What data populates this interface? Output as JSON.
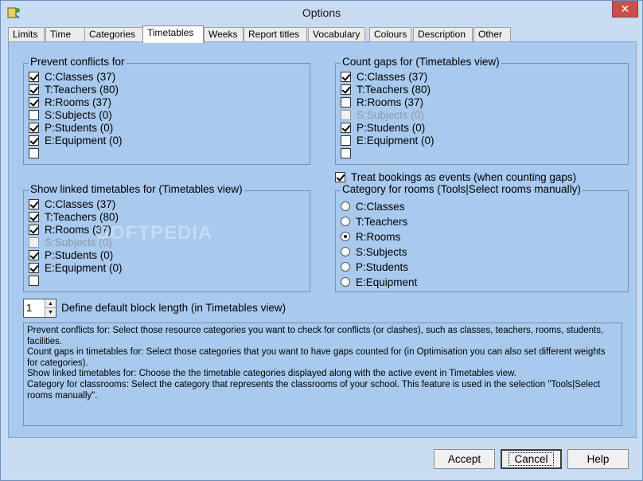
{
  "window": {
    "title": "Options",
    "close_label": "✕"
  },
  "tabs": [
    {
      "label": "Limits"
    },
    {
      "label": "Time"
    },
    {
      "label": "Categories"
    },
    {
      "label": "Timetables"
    },
    {
      "label": "Weeks"
    },
    {
      "label": "Report titles"
    },
    {
      "label": "Vocabulary"
    },
    {
      "label": "Colours"
    },
    {
      "label": "Description"
    },
    {
      "label": "Other"
    }
  ],
  "active_tab": "Timetables",
  "prevent_conflicts": {
    "legend": "Prevent conflicts for",
    "items": [
      {
        "label": "C:Classes (37)",
        "checked": true
      },
      {
        "label": "T:Teachers (80)",
        "checked": true
      },
      {
        "label": "R:Rooms (37)",
        "checked": true
      },
      {
        "label": "S:Subjects (0)",
        "checked": false
      },
      {
        "label": "P:Students (0)",
        "checked": true
      },
      {
        "label": "E:Equipment (0)",
        "checked": true
      },
      {
        "label": "",
        "checked": false
      }
    ]
  },
  "count_gaps": {
    "legend": "Count gaps for (Timetables view)",
    "items": [
      {
        "label": "C:Classes (37)",
        "checked": true
      },
      {
        "label": "T:Teachers (80)",
        "checked": true
      },
      {
        "label": "R:Rooms (37)",
        "checked": false
      },
      {
        "label": "S:Subjects (0)",
        "checked": false,
        "disabled": true
      },
      {
        "label": "P:Students (0)",
        "checked": true
      },
      {
        "label": "E:Equipment (0)",
        "checked": false
      },
      {
        "label": "",
        "checked": false
      }
    ]
  },
  "treat_bookings": {
    "label": "Treat bookings as events (when counting gaps)",
    "checked": true
  },
  "linked_timetables": {
    "legend": "Show linked timetables for (Timetables view)",
    "items": [
      {
        "label": "C:Classes (37)",
        "checked": true
      },
      {
        "label": "T:Teachers (80)",
        "checked": true
      },
      {
        "label": "R:Rooms (37)",
        "checked": true
      },
      {
        "label": "S:Subjects (0)",
        "checked": false,
        "disabled": true
      },
      {
        "label": "P:Students (0)",
        "checked": true
      },
      {
        "label": "E:Equipment (0)",
        "checked": true
      },
      {
        "label": "",
        "checked": false
      }
    ]
  },
  "rooms_category": {
    "legend": "Category for rooms (Tools|Select rooms manually)",
    "options": [
      {
        "label": "C:Classes"
      },
      {
        "label": "T:Teachers"
      },
      {
        "label": "R:Rooms"
      },
      {
        "label": "S:Subjects"
      },
      {
        "label": "P:Students"
      },
      {
        "label": "E:Equipment"
      }
    ],
    "selected": "R:Rooms"
  },
  "block_length": {
    "value": "1",
    "label": "Define default block length (in Timetables view)"
  },
  "help_text": [
    "Prevent conflicts for: Select those resource categories you want to check for conflicts (or clashes), such as classes, teachers, rooms, students, facilities.",
    "Count gaps in timetables for: Select those categories that you want to have gaps counted for (in Optimisation you can also set different weights for categories).",
    "Show linked timetables for: Choose the the timetable categories displayed along with the active event in Timetables view.",
    "Category for classrooms: Select the category that represents the classrooms of your school. This feature is used in the selection \"Tools|Select rooms manually\"."
  ],
  "buttons": {
    "accept": "Accept",
    "cancel": "Cancel",
    "help": "Help"
  },
  "watermark": "SOFTPEDIA"
}
